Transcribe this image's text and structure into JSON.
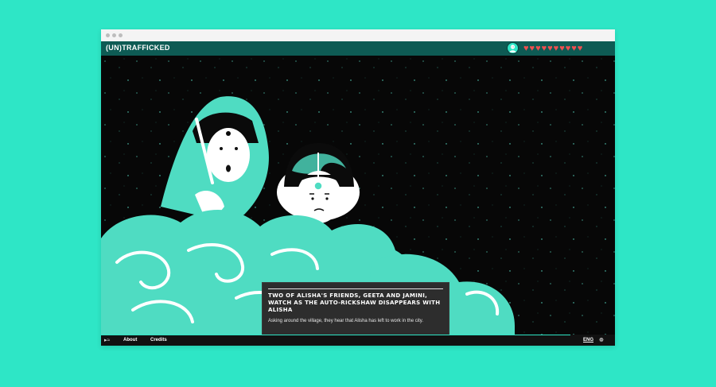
{
  "app": {
    "logo": "(UN)TRAFFICKED"
  },
  "header": {
    "avatar_icon": "person-avatar-icon",
    "hearts_count": 10,
    "heart_icon": "heart-icon",
    "heart_color": "#ef4f4f"
  },
  "caption": {
    "title": "TWO OF ALISHA'S FRIENDS, GEETA AND JAMINI, WATCH AS THE AUTO-RICKSHAW DISAPPEARS WITH ALISHA",
    "body": "Asking around the village, they hear that Alisha has left to work in the city."
  },
  "controls": {
    "next_icon": "chevron-right-icon",
    "next_glyph": "›"
  },
  "footer": {
    "sound_icon": "speaker-icon",
    "about": "About",
    "credits": "Credits",
    "language": "ENG",
    "settings_icon": "settings-icon"
  },
  "colors": {
    "background": "#2ee6c6",
    "header": "#0e5b54",
    "accent": "#ffd024",
    "teal": "#4fdcc2"
  }
}
